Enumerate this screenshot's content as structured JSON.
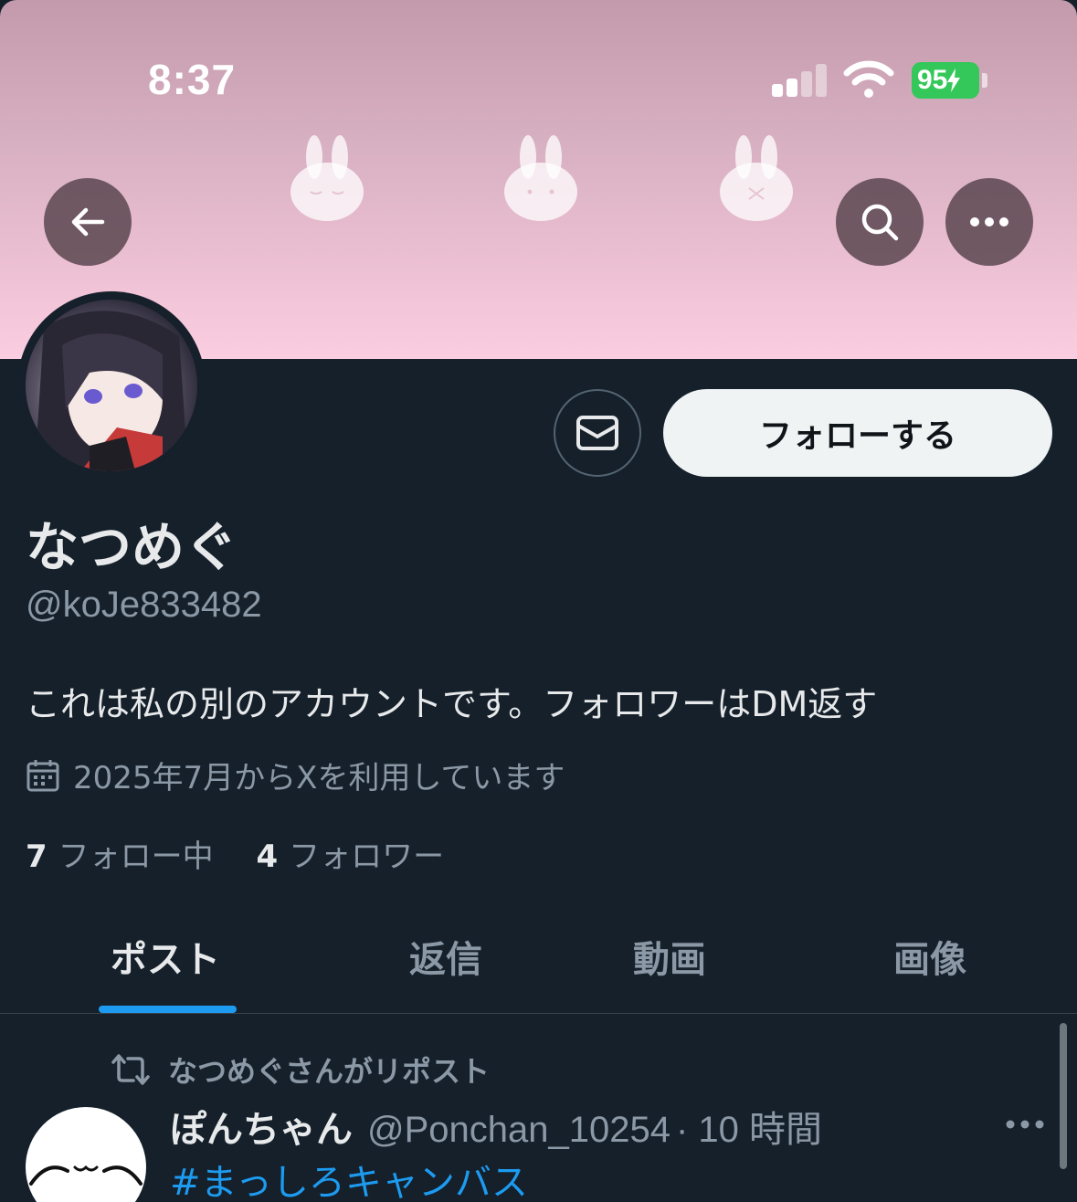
{
  "status_bar": {
    "time": "8:37",
    "battery": "95"
  },
  "profile": {
    "display_name": "なつめぐ",
    "handle": "@koJe833482",
    "bio": "これは私の別のアカウントです。フォロワーはDM返す",
    "joined": "2025年7月からXを利用しています",
    "following_count": "7",
    "following_label": "フォロー中",
    "followers_count": "4",
    "followers_label": "フォロワー",
    "follow_button": "フォローする"
  },
  "tabs": [
    {
      "label": "ポスト",
      "active": true
    },
    {
      "label": "返信",
      "active": false
    },
    {
      "label": "動画",
      "active": false
    },
    {
      "label": "画像",
      "active": false
    }
  ],
  "post": {
    "repost_label": "なつめぐさんがリポスト",
    "author_name": "ぽんちゃん",
    "author_handle": "@Ponchan_10254",
    "time": "· 10 時間",
    "text": "#まっしろキャンバス"
  },
  "colors": {
    "background": "#15202b",
    "accent": "#1d9bf0",
    "banner": "#f0c3d6",
    "battery": "#34c759"
  },
  "icons": [
    "back-arrow-icon",
    "search-icon",
    "more-icon",
    "mail-icon",
    "calendar-icon",
    "repost-icon",
    "wifi-icon",
    "signal-icon"
  ]
}
